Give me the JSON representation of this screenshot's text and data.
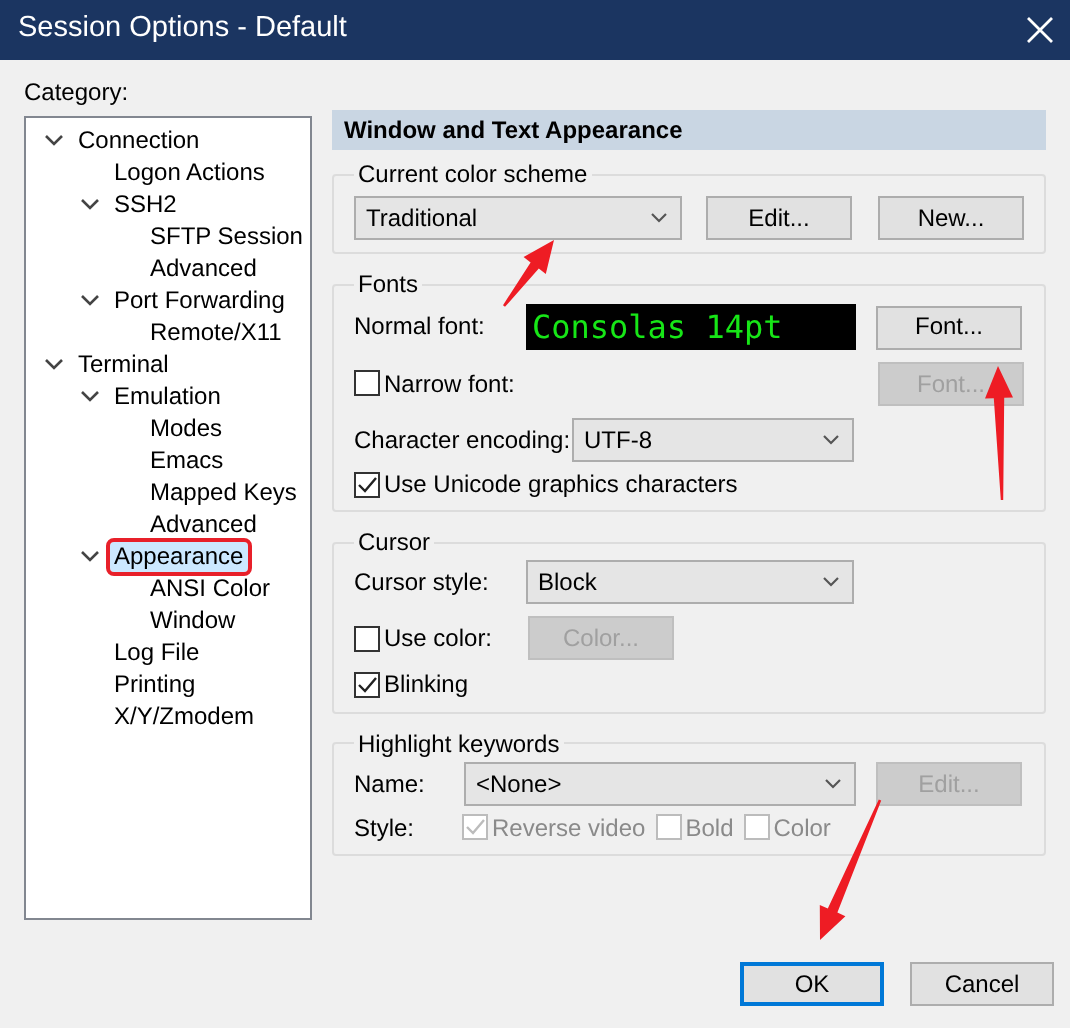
{
  "window": {
    "title": "Session Options - Default"
  },
  "category": {
    "label": "Category:",
    "tree": [
      {
        "label": "Connection",
        "expanded": true,
        "selected": false,
        "marked": false,
        "children": [
          {
            "label": "Logon Actions",
            "selected": false,
            "marked": false
          },
          {
            "label": "SSH2",
            "expanded": true,
            "selected": false,
            "marked": false,
            "children": [
              {
                "label": "SFTP Session",
                "selected": false,
                "marked": false
              },
              {
                "label": "Advanced",
                "selected": false,
                "marked": false
              }
            ]
          },
          {
            "label": "Port Forwarding",
            "expanded": true,
            "selected": false,
            "marked": false,
            "children": [
              {
                "label": "Remote/X11",
                "selected": false,
                "marked": false
              }
            ]
          }
        ]
      },
      {
        "label": "Terminal",
        "expanded": true,
        "selected": false,
        "marked": false,
        "children": [
          {
            "label": "Emulation",
            "expanded": true,
            "selected": false,
            "marked": false,
            "children": [
              {
                "label": "Modes",
                "selected": false,
                "marked": false
              },
              {
                "label": "Emacs",
                "selected": false,
                "marked": false
              },
              {
                "label": "Mapped Keys",
                "selected": false,
                "marked": false
              },
              {
                "label": "Advanced",
                "selected": false,
                "marked": false
              }
            ]
          },
          {
            "label": "Appearance",
            "expanded": true,
            "selected": true,
            "marked": true,
            "children": [
              {
                "label": "ANSI Color",
                "selected": false,
                "marked": false
              },
              {
                "label": "Window",
                "selected": false,
                "marked": false
              }
            ]
          },
          {
            "label": "Log File",
            "selected": false,
            "marked": false
          },
          {
            "label": "Printing",
            "selected": false,
            "marked": false
          },
          {
            "label": "X/Y/Zmodem",
            "selected": false,
            "marked": false
          }
        ]
      }
    ]
  },
  "panel": {
    "title": "Window and Text Appearance",
    "color_scheme": {
      "label": "Current color scheme",
      "value": "Traditional",
      "buttons": [
        {
          "label": "Edit...",
          "disabled": false
        },
        {
          "label": "New...",
          "disabled": false
        }
      ]
    },
    "fonts": {
      "label": "Fonts",
      "normal_font_label": "Normal font:",
      "normal_font_preview": "Consolas 14pt",
      "font_button": {
        "label": "Font...",
        "disabled": false
      },
      "narrow_font": {
        "label": "Narrow font:",
        "checked": false
      },
      "narrow_font_button": {
        "label": "Font...",
        "disabled": true
      },
      "encoding_label": "Character encoding:",
      "encoding_value": "UTF-8",
      "unicode_graphics": {
        "label": "Use Unicode graphics characters",
        "checked": true
      }
    },
    "cursor": {
      "label": "Cursor",
      "style_label": "Cursor style:",
      "style_value": "Block",
      "use_color": {
        "label": "Use color:",
        "checked": false
      },
      "color_button": {
        "label": "Color...",
        "disabled": true
      },
      "blinking": {
        "label": "Blinking",
        "checked": true
      }
    },
    "highlight": {
      "label": "Highlight keywords",
      "name_label": "Name:",
      "name_value": "<None>",
      "edit_button": {
        "label": "Edit...",
        "disabled": true
      },
      "style_label": "Style:",
      "style_options": [
        {
          "label": "Reverse video",
          "checked": true,
          "disabled": true
        },
        {
          "label": "Bold",
          "checked": false,
          "disabled": true
        },
        {
          "label": "Color",
          "checked": false,
          "disabled": true
        }
      ]
    }
  },
  "buttons": [
    {
      "label": "OK",
      "default": true
    },
    {
      "label": "Cancel",
      "default": false
    }
  ]
}
